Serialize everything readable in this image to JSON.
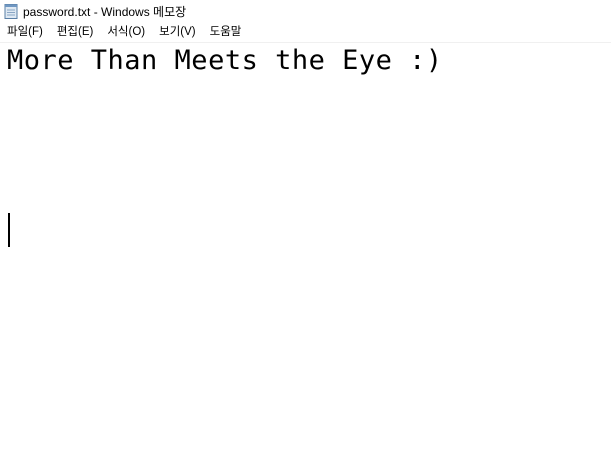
{
  "window": {
    "title": "password.txt - Windows 메모장",
    "icon": "notepad-icon"
  },
  "menu": [
    {
      "label": "파일(F)"
    },
    {
      "label": "편집(E)"
    },
    {
      "label": "서식(O)"
    },
    {
      "label": "보기(V)"
    },
    {
      "label": "도움말"
    }
  ],
  "editor": {
    "content": "More Than Meets the Eye :)"
  }
}
